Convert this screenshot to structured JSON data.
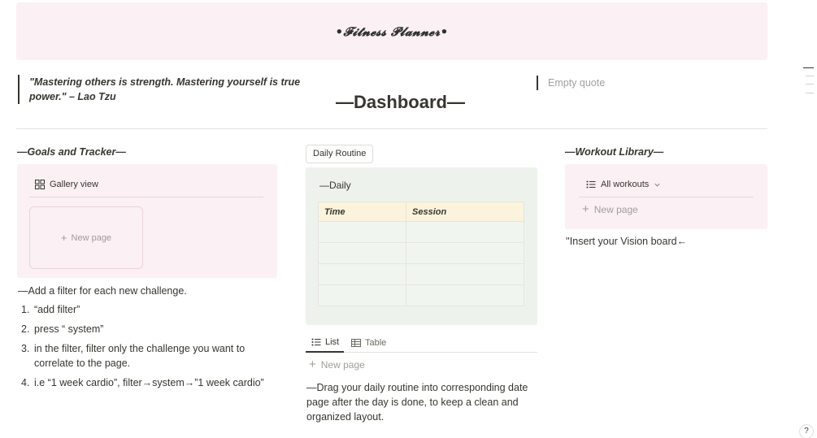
{
  "banner": {
    "title": "•𝓕𝓲𝓽𝓷𝓮𝓼𝓼 𝓟𝓵𝓪𝓷𝓷𝓮𝓻•"
  },
  "quote_left": {
    "text": "\"Mastering others is strength. Mastering yourself is true power.\" – Lao Tzu"
  },
  "quote_right": {
    "placeholder": "Empty quote"
  },
  "dashboard_title": "—Dashboard—",
  "goals": {
    "heading": "—Goals and Tracker—",
    "view_label": "Gallery view",
    "new_page_label": "New page",
    "filter_note": "—Add a filter for each new challenge.",
    "steps": [
      {
        "num": "1.",
        "text": "“add filter”"
      },
      {
        "num": "2.",
        "text": "press “ system”"
      },
      {
        "num": "3.",
        "text": "in the filter, filter only the challenge you want to correlate to the page."
      },
      {
        "num": "4.",
        "text": "i.e “1 week cardio”, filter→system→”1 week cardio”"
      }
    ]
  },
  "routine": {
    "button_label": "Daily Routine",
    "daily_title": "—Daily",
    "columns": [
      "Time",
      "Session"
    ],
    "tabs": [
      {
        "label": "List",
        "active": true
      },
      {
        "label": "Table",
        "active": false
      }
    ],
    "new_page_label": "New page",
    "note": "—Drag your daily routine into corresponding date page after the day is done, to keep a clean and organized layout."
  },
  "workout": {
    "heading": "—Workout Library—",
    "view_label": "All workouts",
    "new_page_label": "New page",
    "vision_note": "''Insert your Vision board←"
  },
  "help": {
    "label": "?"
  },
  "colors": {
    "pink": "#fbf0f4",
    "green": "#edf3ec",
    "header_yellow": "#fbf3db"
  }
}
